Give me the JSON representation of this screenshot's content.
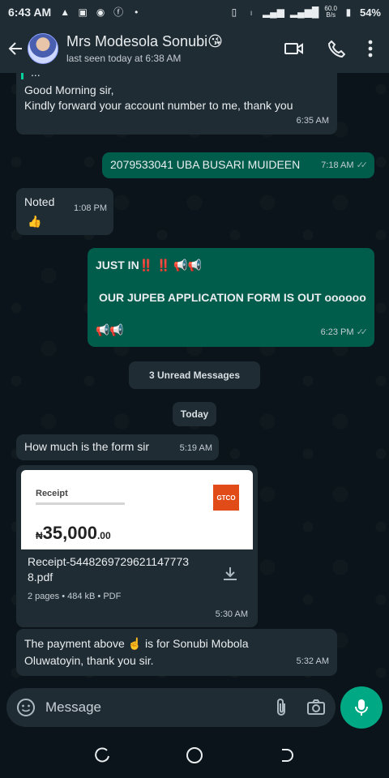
{
  "status_bar": {
    "time": "6:43 AM",
    "speed_value": "60.0",
    "speed_unit": "B/s",
    "battery": "54%",
    "left_icons": [
      "warning-icon",
      "news-icon",
      "messenger-icon",
      "facebook-icon",
      "dot-icon"
    ],
    "right_icons": [
      "vibrate-icon",
      "volte-icon",
      "signal-icon",
      "signal-icon",
      "battery-icon"
    ]
  },
  "header": {
    "contact_name": "Mrs Modesola Sonubi😘",
    "last_seen": "last seen today at 6:38 AM",
    "actions": [
      "video-call-icon",
      "voice-call-icon",
      "more-options-icon"
    ]
  },
  "messages": {
    "m1": {
      "quote": "...",
      "text_line1": "Good Morning sir,",
      "text_line2": "Kindly forward your account number to me, thank you",
      "time": "6:35 AM"
    },
    "m2": {
      "text": "2079533041 UBA BUSARI MUIDEEN",
      "time": "7:18 AM",
      "status": "read"
    },
    "m3": {
      "text": "Noted",
      "time": "1:08 PM",
      "emoji": "👍"
    },
    "m4": {
      "line1": "JUST IN‼️ ‼️ 📢📢",
      "line2": "OUR JUPEB APPLICATION FORM IS OUT oooooo",
      "line3": "📢📢",
      "time": "6:23 PM",
      "status": "read"
    },
    "unread_chip": "3 Unread Messages",
    "date_chip": "Today",
    "m5": {
      "text": "How much is the form sir",
      "time": "5:19 AM"
    },
    "m6": {
      "receipt_title": "Receipt",
      "bank": "GTCO",
      "currency": "₦",
      "amount": "35,000",
      "amount_decimal": ".00",
      "file_name": "Receipt-54482697296211477738.pdf",
      "file_meta": "2 pages • 484 kB • PDF",
      "time": "5:30 AM"
    },
    "m7": {
      "line1": "The payment above ☝️ is for Sonubi Mobola",
      "line2": "Oluwatoyin, thank you sir.",
      "time": "5:32 AM"
    }
  },
  "composer": {
    "placeholder": "Message",
    "icons": [
      "emoji-icon",
      "attach-icon",
      "camera-icon",
      "mic-icon"
    ]
  },
  "nav": [
    "recents-icon",
    "home-icon",
    "back-icon"
  ],
  "colors": {
    "background": "#0b141a",
    "bar": "#1f2c34",
    "incoming": "#1f2c34",
    "outgoing": "#005c4b",
    "accent": "#00a884",
    "read_tick": "#8fb3ad"
  }
}
